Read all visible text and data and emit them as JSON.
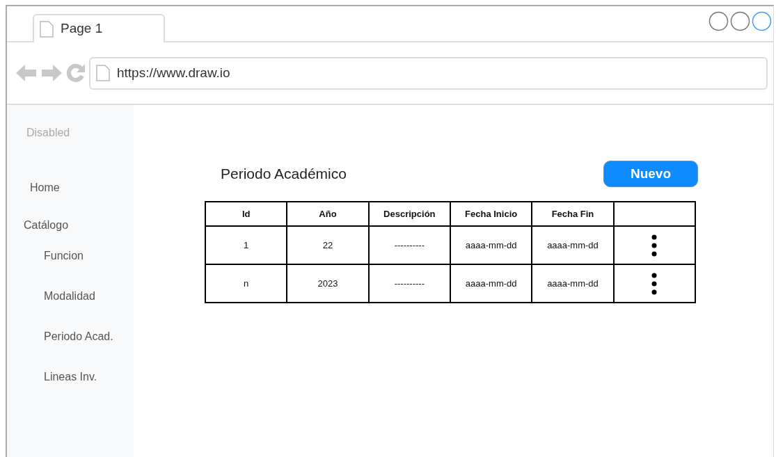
{
  "browser": {
    "tab": {
      "label": "Page 1"
    },
    "url": "https://www.draw.io"
  },
  "sidebar": {
    "items": [
      {
        "label": "Disabled",
        "disabled": true
      },
      {
        "label": "Home",
        "disabled": false
      },
      {
        "label": "Catálogo",
        "disabled": false,
        "children": [
          {
            "label": "Funcion",
            "disabled": false
          },
          {
            "label": "Modalidad",
            "disabled": false
          },
          {
            "label": "Periodo Acad.",
            "disabled": false
          },
          {
            "label": "Lineas Inv.",
            "disabled": false
          }
        ]
      }
    ]
  },
  "page": {
    "title": "Periodo Académico",
    "new_button": "Nuevo"
  },
  "table": {
    "columns": [
      "Id",
      "Año",
      "Descripción",
      "Fecha Inicio",
      "Fecha Fin"
    ],
    "rows": [
      {
        "cells": [
          "1",
          "22",
          "----------",
          "aaaa-mm-dd",
          "aaaa-mm-dd"
        ]
      },
      {
        "cells": [
          "n",
          "2023",
          "----------",
          "aaaa-mm-dd",
          "aaaa-mm-dd"
        ]
      }
    ]
  }
}
